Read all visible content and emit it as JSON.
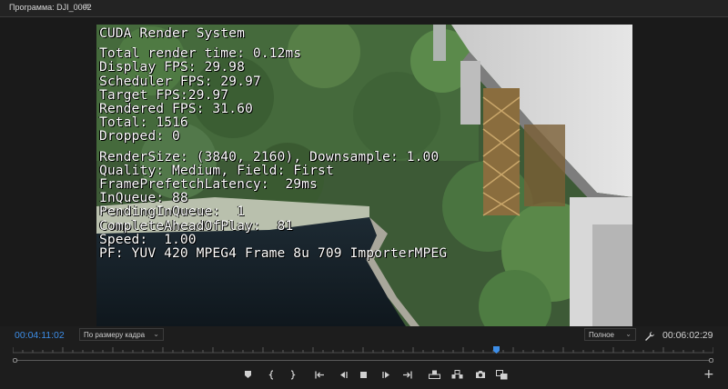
{
  "panel": {
    "title": "Программа: DJI_0002",
    "menu_icon": "hamburger-menu-icon"
  },
  "overlay": {
    "header": "CUDA Render System",
    "stats": [
      "Total render time: 0.12ms",
      "Display FPS: 29.98",
      "Scheduler FPS: 29.97",
      "Target FPS:29.97",
      "Rendered FPS: 31.60",
      "Total: 1516",
      "Dropped: 0"
    ],
    "details": [
      "RenderSize: (3840, 2160), Downsample: 1.00",
      "Quality: Medium, Field: First",
      "FramePrefetchLatency:  29ms",
      "InQueue: 88",
      "PendingInQueue:  1",
      "CompleteAheadOfPlay:  81",
      "Speed:  1.00",
      "PF: YUV 420 MPEG4 Frame 8u 709 ImporterMPEG"
    ]
  },
  "footer": {
    "current_timecode": "00:04:11:02",
    "fit_select": "По размеру кадра",
    "quality_select": "Полное",
    "duration_timecode": "00:06:02:29",
    "playhead_fraction": 0.69
  },
  "transport": [
    {
      "name": "add-marker-icon"
    },
    {
      "name": "mark-in-icon"
    },
    {
      "name": "mark-out-icon"
    },
    {
      "name": "go-to-in-icon"
    },
    {
      "name": "step-back-icon"
    },
    {
      "name": "stop-icon"
    },
    {
      "name": "step-forward-icon"
    },
    {
      "name": "go-to-out-icon"
    },
    {
      "name": "lift-icon"
    },
    {
      "name": "extract-icon"
    },
    {
      "name": "export-frame-icon"
    },
    {
      "name": "compare-view-icon"
    }
  ],
  "colors": {
    "accent": "#3d8ee8",
    "panel_bg": "#1d1d1d"
  }
}
